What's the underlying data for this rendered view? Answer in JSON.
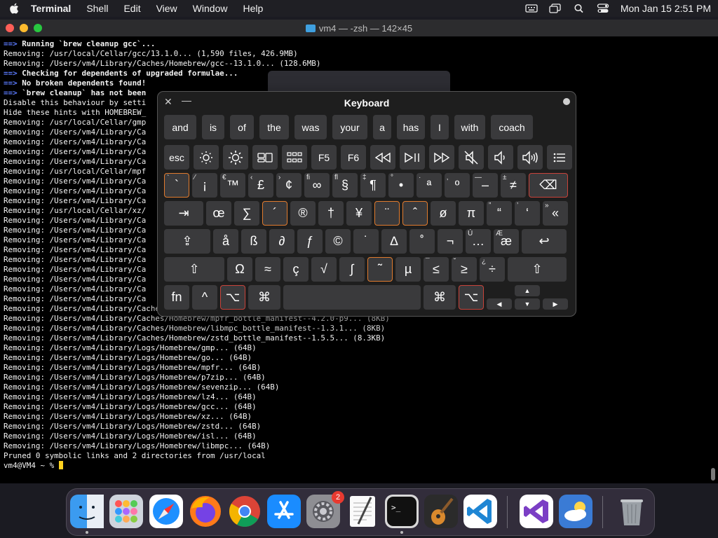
{
  "menubar": {
    "app": "Terminal",
    "items": [
      "Shell",
      "Edit",
      "View",
      "Window",
      "Help"
    ],
    "clock": "Mon Jan 15  2:51 PM"
  },
  "window": {
    "title": "vm4 — -zsh — 142×45"
  },
  "terminal": {
    "lines": [
      {
        "prefix": "==>",
        "text": " Running `brew cleanup gcc`...",
        "bold": true
      },
      {
        "prefix": "",
        "text": "Removing: /usr/local/Cellar/gcc/13.1.0... (1,590 files, 426.9MB)"
      },
      {
        "prefix": "",
        "text": "Removing: /Users/vm4/Library/Caches/Homebrew/gcc--13.1.0... (128.6MB)"
      },
      {
        "prefix": "==>",
        "text": " Checking for dependents of upgraded formulae...",
        "bold": true
      },
      {
        "prefix": "==>",
        "text": " No broken dependents found!",
        "bold": true
      },
      {
        "prefix": "==>",
        "text": " `brew cleanup` has not been",
        "bold": true
      },
      {
        "prefix": "",
        "text": "Disable this behaviour by setti"
      },
      {
        "prefix": "",
        "text": "Hide these hints with HOMEBREW_"
      },
      {
        "prefix": "",
        "text": "Removing: /usr/local/Cellar/gmp"
      },
      {
        "prefix": "",
        "text": "Removing: /Users/vm4/Library/Ca"
      },
      {
        "prefix": "",
        "text": "Removing: /Users/vm4/Library/Ca"
      },
      {
        "prefix": "",
        "text": "Removing: /Users/vm4/Library/Ca"
      },
      {
        "prefix": "",
        "text": "Removing: /Users/vm4/Library/Ca"
      },
      {
        "prefix": "",
        "text": "Removing: /usr/local/Cellar/mpf"
      },
      {
        "prefix": "",
        "text": "Removing: /Users/vm4/Library/Ca"
      },
      {
        "prefix": "",
        "text": "Removing: /Users/vm4/Library/Ca"
      },
      {
        "prefix": "",
        "text": "Removing: /Users/vm4/Library/Ca"
      },
      {
        "prefix": "",
        "text": "Removing: /usr/local/Cellar/xz/"
      },
      {
        "prefix": "",
        "text": "Removing: /Users/vm4/Library/Ca"
      },
      {
        "prefix": "",
        "text": "Removing: /Users/vm4/Library/Ca"
      },
      {
        "prefix": "",
        "text": "Removing: /Users/vm4/Library/Ca"
      },
      {
        "prefix": "",
        "text": "Removing: /Users/vm4/Library/Ca"
      },
      {
        "prefix": "",
        "text": "Removing: /Users/vm4/Library/Ca"
      },
      {
        "prefix": "",
        "text": "Removing: /Users/vm4/Library/Ca"
      },
      {
        "prefix": "",
        "text": "Removing: /Users/vm4/Library/Ca"
      },
      {
        "prefix": "",
        "text": "Removing: /Users/vm4/Library/Ca"
      },
      {
        "prefix": "",
        "text": "Removing: /Users/vm4/Library/Ca"
      },
      {
        "prefix": "",
        "text": "Removing: /Users/vm4/Library/Caches/Homebrew/xz_bottle_manifest--5.4.3... (7.5KB)"
      },
      {
        "prefix": "",
        "text": "Removing: /Users/vm4/Library/Caches/Homebrew/mpfr_bottle_manifest--4.2.0-p9... (8KB)"
      },
      {
        "prefix": "",
        "text": "Removing: /Users/vm4/Library/Caches/Homebrew/libmpc_bottle_manifest--1.3.1... (8KB)"
      },
      {
        "prefix": "",
        "text": "Removing: /Users/vm4/Library/Caches/Homebrew/zstd_bottle_manifest--1.5.5... (8.3KB)"
      },
      {
        "prefix": "",
        "text": "Removing: /Users/vm4/Library/Logs/Homebrew/gmp... (64B)"
      },
      {
        "prefix": "",
        "text": "Removing: /Users/vm4/Library/Logs/Homebrew/go... (64B)"
      },
      {
        "prefix": "",
        "text": "Removing: /Users/vm4/Library/Logs/Homebrew/mpfr... (64B)"
      },
      {
        "prefix": "",
        "text": "Removing: /Users/vm4/Library/Logs/Homebrew/p7zip... (64B)"
      },
      {
        "prefix": "",
        "text": "Removing: /Users/vm4/Library/Logs/Homebrew/sevenzip... (64B)"
      },
      {
        "prefix": "",
        "text": "Removing: /Users/vm4/Library/Logs/Homebrew/lz4... (64B)"
      },
      {
        "prefix": "",
        "text": "Removing: /Users/vm4/Library/Logs/Homebrew/gcc... (64B)"
      },
      {
        "prefix": "",
        "text": "Removing: /Users/vm4/Library/Logs/Homebrew/xz... (64B)"
      },
      {
        "prefix": "",
        "text": "Removing: /Users/vm4/Library/Logs/Homebrew/zstd... (64B)"
      },
      {
        "prefix": "",
        "text": "Removing: /Users/vm4/Library/Logs/Homebrew/isl... (64B)"
      },
      {
        "prefix": "",
        "text": "Removing: /Users/vm4/Library/Logs/Homebrew/libmpc... (64B)"
      },
      {
        "prefix": "",
        "text": "Pruned 0 symbolic links and 2 directories from /usr/local"
      }
    ],
    "prompt": "vm4@VM4 ~ % "
  },
  "keyboard": {
    "title": "Keyboard",
    "suggestions": [
      "and",
      "is",
      "of",
      "the",
      "was",
      "your",
      "a",
      "has",
      "I",
      "with",
      "coach"
    ],
    "fn_row": [
      "esc",
      "brightness-down-icon",
      "brightness-up-icon",
      "mission-control-icon",
      "launchpad-icon",
      "F5",
      "F6",
      "rewind-icon",
      "play-pause-icon",
      "fast-forward-icon",
      "mute-icon",
      "volume-down-icon",
      "volume-up-icon",
      "list-icon"
    ],
    "row1": [
      {
        "sub": "`",
        "main": "`"
      },
      {
        "sub": "⁄",
        "main": "¡"
      },
      {
        "sub": "€",
        "main": "™"
      },
      {
        "sub": "‹",
        "main": "£"
      },
      {
        "sub": "›",
        "main": "¢"
      },
      {
        "sub": "ﬁ",
        "main": "∞"
      },
      {
        "sub": "ﬂ",
        "main": "§"
      },
      {
        "sub": "‡",
        "main": "¶"
      },
      {
        "sub": "°",
        "main": "•"
      },
      {
        "sub": "·",
        "main": "ª"
      },
      {
        "sub": "‚",
        "main": "º"
      },
      {
        "sub": "—",
        "main": "–"
      },
      {
        "sub": "±",
        "main": "≠"
      }
    ],
    "row2": [
      {
        "sub": "",
        "main": "œ"
      },
      {
        "sub": "",
        "main": "∑"
      },
      {
        "sub": "",
        "main": "´"
      },
      {
        "sub": "",
        "main": "®"
      },
      {
        "sub": "",
        "main": "†"
      },
      {
        "sub": "",
        "main": "¥"
      },
      {
        "sub": "",
        "main": "¨"
      },
      {
        "sub": "",
        "main": "ˆ"
      },
      {
        "sub": "",
        "main": "ø"
      },
      {
        "sub": "",
        "main": "π"
      },
      {
        "sub": "”",
        "main": "“"
      },
      {
        "sub": "’",
        "main": "‘"
      },
      {
        "sub": "»",
        "main": "«"
      }
    ],
    "row3": [
      {
        "sub": "",
        "main": "å"
      },
      {
        "sub": "",
        "main": "ß"
      },
      {
        "sub": "",
        "main": "∂"
      },
      {
        "sub": "",
        "main": "ƒ"
      },
      {
        "sub": "",
        "main": "©"
      },
      {
        "sub": "",
        "main": "˙"
      },
      {
        "sub": "",
        "main": "∆"
      },
      {
        "sub": "",
        "main": "˚"
      },
      {
        "sub": "",
        "main": "¬"
      },
      {
        "sub": "Ú",
        "main": "…"
      },
      {
        "sub": "Æ",
        "main": "æ"
      }
    ],
    "row4": [
      {
        "sub": "",
        "main": "Ω"
      },
      {
        "sub": "",
        "main": "≈"
      },
      {
        "sub": "",
        "main": "ç"
      },
      {
        "sub": "",
        "main": "√"
      },
      {
        "sub": "",
        "main": "∫"
      },
      {
        "sub": "",
        "main": "˜"
      },
      {
        "sub": "",
        "main": "µ"
      },
      {
        "sub": "¯",
        "main": "≤"
      },
      {
        "sub": "˘",
        "main": "≥"
      },
      {
        "sub": "¿",
        "main": "÷"
      }
    ],
    "bottom": {
      "fn": "fn",
      "ctrl": "^",
      "opt": "⌥",
      "cmd": "⌘"
    },
    "glyphs": {
      "tab": "⇥",
      "caps": "⇪",
      "shift": "⇧",
      "return": "↩",
      "delete": "⌫",
      "up": "▲",
      "down": "▼",
      "left": "◀",
      "right": "▶"
    }
  },
  "dock": {
    "items": [
      "finder-icon",
      "launchpad-icon",
      "safari-icon",
      "firefox-icon",
      "chrome-icon",
      "app-store-icon",
      "system-settings-icon",
      "textedit-icon",
      "terminal-icon",
      "garageband-icon",
      "vscode-icon",
      "visual-studio-icon",
      "weather-icon",
      "trash-icon"
    ],
    "settings_badge": "2"
  },
  "colors": {
    "accent_orange": "#e07b2e",
    "accent_red": "#c8433a",
    "prompt_arrow": "#5b7bff",
    "cursor": "#ffd21f"
  }
}
